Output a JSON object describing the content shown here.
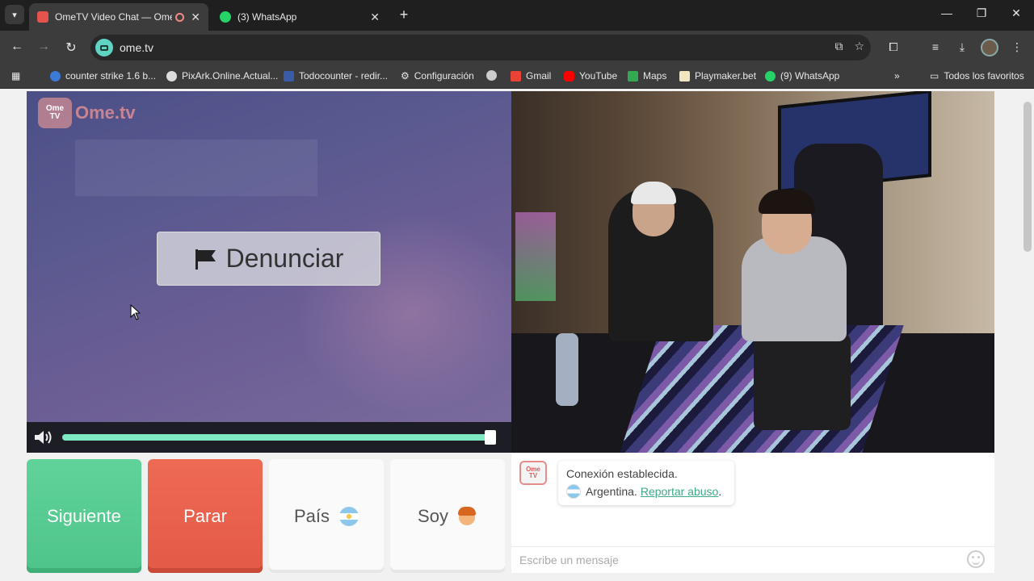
{
  "browser": {
    "tabs": [
      {
        "title": "OmeTV Video Chat — Omegle",
        "active": true
      },
      {
        "title": "(3) WhatsApp",
        "active": false
      }
    ],
    "new_tab_label": "+",
    "url": "ome.tv",
    "bookmarks": [
      {
        "label": "counter strike 1.6 b..."
      },
      {
        "label": "PixArk.Online.Actual..."
      },
      {
        "label": "Todocounter - redir..."
      },
      {
        "label": "Configuración"
      },
      {
        "label": "Gmail"
      },
      {
        "label": "YouTube"
      },
      {
        "label": "Maps"
      },
      {
        "label": "Playmaker.bet"
      },
      {
        "label": "(9) WhatsApp"
      }
    ],
    "bookmarks_overflow": "»",
    "all_bookmarks": "Todos los favoritos"
  },
  "ometv": {
    "logo_box": [
      "Ome",
      "TV"
    ],
    "logo_text": "Ome.tv",
    "report_button": "Denunciar",
    "volume_level": 0.99,
    "controls": {
      "next": "Siguiente",
      "stop": "Parar",
      "country": "País",
      "gender": "Soy"
    },
    "chat": {
      "logo": [
        "Ome",
        "TV"
      ],
      "connected": "Conexión establecida.",
      "country": "Argentina.",
      "report_link": "Reportar abuso",
      "report_suffix": ".",
      "input_placeholder": "Escribe un mensaje"
    }
  },
  "colors": {
    "next": "#5fd39a",
    "stop": "#ee6a55",
    "accent": "#7ee8c3",
    "link": "#3ea88a"
  }
}
